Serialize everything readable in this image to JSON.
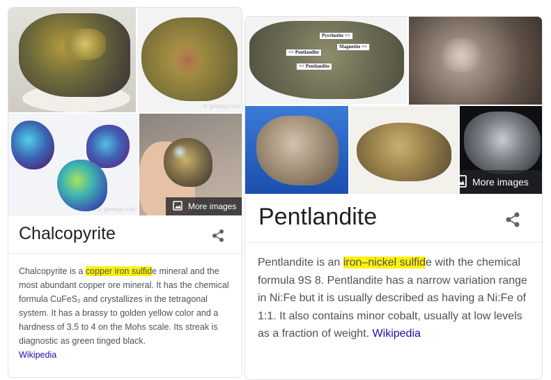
{
  "left_card": {
    "title": "Chalcopyrite",
    "more_images": "More images",
    "watermark": "© geology.com",
    "desc_before": "Chalcopyrite is a ",
    "desc_highlight": "copper iron sulfid",
    "desc_after": "e mineral and the most abundant copper ore mineral. It has the chemical formula CuFeS₂ and crystallizes in the tetragonal system. It has a brassy to golden yellow color and a hardness of 3.5 to 4 on the Mohs scale. Its streak is diagnostic as green tinged black.",
    "source": "Wikipedia"
  },
  "right_card": {
    "title": "Pentlandite",
    "more_images": "More images",
    "desc_before": "Pentlandite is an ",
    "desc_highlight": "iron–nickel sulfid",
    "desc_after": "e with the chemical formula 9S 8. Pentlandite has a narrow variation range in Ni:Fe but it is usually described as having a Ni:Fe of 1:1. It also contains minor cobalt, usually at low levels as a fraction of weight. ",
    "source": "Wikipedia",
    "image_labels": {
      "pyrrhotite": "Pyrrhotite >>",
      "magnetite": "Magnetite >>",
      "pentlandite1": "<< Pentlandite",
      "pentlandite2": "<< Pentlandite"
    }
  },
  "colors": {
    "highlight": "#fff10a",
    "link": "#1a0dab",
    "text": "#4d5156",
    "title": "#202124",
    "border": "#dfe1e5"
  },
  "icons": {
    "share": "share-icon",
    "more_images": "image-icon"
  }
}
